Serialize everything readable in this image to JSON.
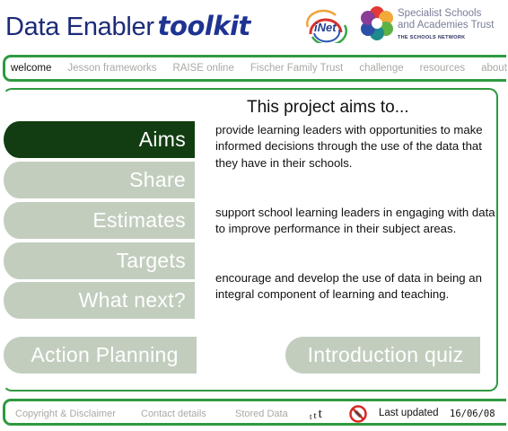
{
  "header": {
    "brand_part1": "Data Enabler",
    "brand_part2": "toolkit",
    "inet_logo_text": "iNet",
    "ssat_line1": "Specialist Schools",
    "ssat_line2": "and Academies Trust",
    "ssat_line3": "THE SCHOOLS NETWORK"
  },
  "nav": {
    "items": [
      {
        "label": "welcome",
        "active": true
      },
      {
        "label": "Jesson frameworks"
      },
      {
        "label": "RAISE online"
      },
      {
        "label": "Fischer Family Trust"
      },
      {
        "label": "challenge"
      },
      {
        "label": "resources"
      },
      {
        "label": "about"
      }
    ]
  },
  "main": {
    "title": "This project aims to...",
    "sections": [
      {
        "label": "Aims",
        "active": true
      },
      {
        "label": "Share"
      },
      {
        "label": "Estimates"
      },
      {
        "label": "Targets"
      },
      {
        "label": "What next?"
      }
    ],
    "aims": [
      "provide learning leaders with opportunities to make informed decisions through the use of the data that they have in their schools.",
      "support school learning leaders in engaging with data to improve performance in their subject areas.",
      "encourage and develop the use of data in being an integral component of learning and teaching."
    ],
    "action_planning_label": "Action Planning",
    "quiz_label": "Introduction quiz"
  },
  "footer": {
    "copyright": "Copyright & Disclaimer",
    "contact": "Contact details",
    "stored": "Stored Data",
    "text_size_small": "t",
    "text_size_medium": "t",
    "text_size_large": "t",
    "last_updated_label": "Last updated",
    "last_updated_date": "16/06/08"
  },
  "colors": {
    "accent_green": "#2e9a40",
    "active_button": "#123d12",
    "inactive_button": "#c2cdbe",
    "brand_blue": "#1c2b78",
    "nav_inactive_text": "#a8aaa6"
  }
}
